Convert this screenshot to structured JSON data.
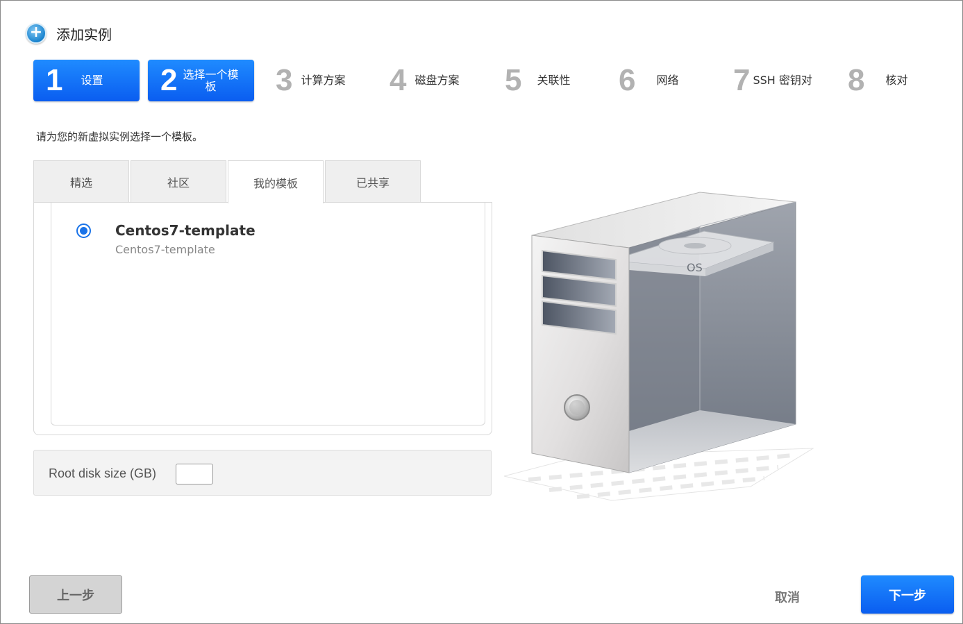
{
  "dialog": {
    "title": "添加实例",
    "icon": "add-circle-icon"
  },
  "steps": [
    {
      "num": "1",
      "label": "设置",
      "active": true
    },
    {
      "num": "2",
      "label": "选择一个模板",
      "active": true
    },
    {
      "num": "3",
      "label": "计算方案",
      "active": false
    },
    {
      "num": "4",
      "label": "磁盘方案",
      "active": false
    },
    {
      "num": "5",
      "label": "关联性",
      "active": false
    },
    {
      "num": "6",
      "label": "网络",
      "active": false
    },
    {
      "num": "7",
      "label": "SSH 密钥对",
      "active": false
    },
    {
      "num": "8",
      "label": "核对",
      "active": false
    }
  ],
  "instructions": "请为您的新虚拟实例选择一个模板。",
  "tabs": [
    {
      "label": "精选",
      "selected": false
    },
    {
      "label": "社区",
      "selected": false
    },
    {
      "label": "我的模板",
      "selected": true
    },
    {
      "label": "已共享",
      "selected": false
    }
  ],
  "templates": [
    {
      "name": "Centos7-template",
      "description": "Centos7-template",
      "selected": true
    }
  ],
  "root_disk": {
    "label": "Root disk size (GB)",
    "value": ""
  },
  "illustration": {
    "os_label": "OS"
  },
  "buttons": {
    "prev": "上一步",
    "cancel": "取消",
    "next": "下一步"
  },
  "colors": {
    "accent": "#0a6cf5",
    "inactive_step_number": "#b2b2b2"
  }
}
